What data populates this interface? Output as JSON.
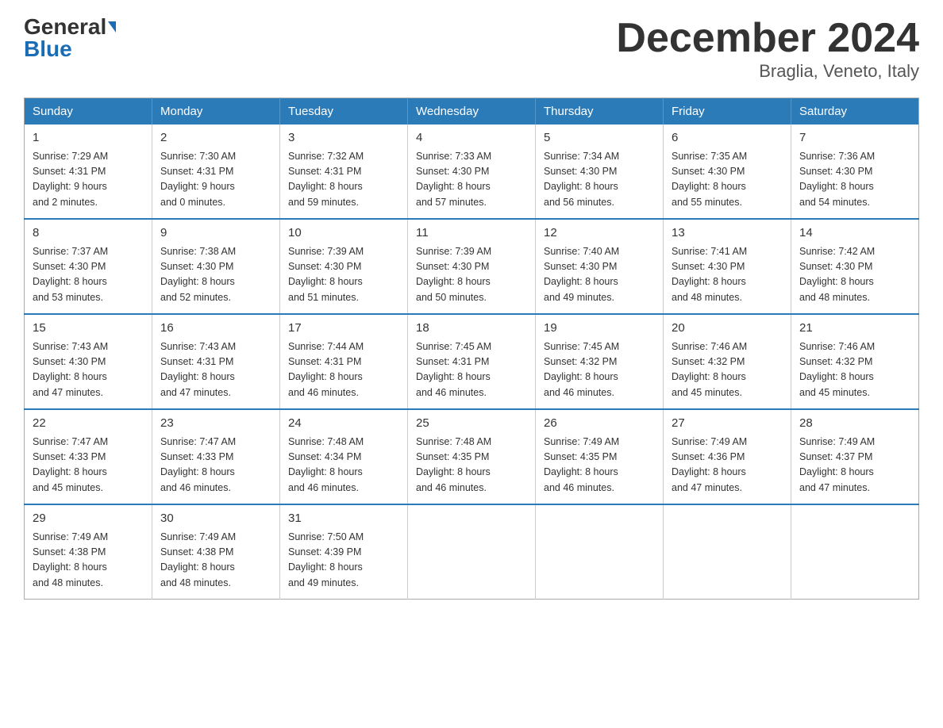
{
  "header": {
    "logo_line1": "General",
    "logo_line2": "Blue",
    "title": "December 2024",
    "subtitle": "Braglia, Veneto, Italy"
  },
  "calendar": {
    "days_of_week": [
      "Sunday",
      "Monday",
      "Tuesday",
      "Wednesday",
      "Thursday",
      "Friday",
      "Saturday"
    ],
    "weeks": [
      [
        {
          "day": "1",
          "sunrise": "7:29 AM",
          "sunset": "4:31 PM",
          "daylight": "9 hours and 2 minutes."
        },
        {
          "day": "2",
          "sunrise": "7:30 AM",
          "sunset": "4:31 PM",
          "daylight": "9 hours and 0 minutes."
        },
        {
          "day": "3",
          "sunrise": "7:32 AM",
          "sunset": "4:31 PM",
          "daylight": "8 hours and 59 minutes."
        },
        {
          "day": "4",
          "sunrise": "7:33 AM",
          "sunset": "4:30 PM",
          "daylight": "8 hours and 57 minutes."
        },
        {
          "day": "5",
          "sunrise": "7:34 AM",
          "sunset": "4:30 PM",
          "daylight": "8 hours and 56 minutes."
        },
        {
          "day": "6",
          "sunrise": "7:35 AM",
          "sunset": "4:30 PM",
          "daylight": "8 hours and 55 minutes."
        },
        {
          "day": "7",
          "sunrise": "7:36 AM",
          "sunset": "4:30 PM",
          "daylight": "8 hours and 54 minutes."
        }
      ],
      [
        {
          "day": "8",
          "sunrise": "7:37 AM",
          "sunset": "4:30 PM",
          "daylight": "8 hours and 53 minutes."
        },
        {
          "day": "9",
          "sunrise": "7:38 AM",
          "sunset": "4:30 PM",
          "daylight": "8 hours and 52 minutes."
        },
        {
          "day": "10",
          "sunrise": "7:39 AM",
          "sunset": "4:30 PM",
          "daylight": "8 hours and 51 minutes."
        },
        {
          "day": "11",
          "sunrise": "7:39 AM",
          "sunset": "4:30 PM",
          "daylight": "8 hours and 50 minutes."
        },
        {
          "day": "12",
          "sunrise": "7:40 AM",
          "sunset": "4:30 PM",
          "daylight": "8 hours and 49 minutes."
        },
        {
          "day": "13",
          "sunrise": "7:41 AM",
          "sunset": "4:30 PM",
          "daylight": "8 hours and 48 minutes."
        },
        {
          "day": "14",
          "sunrise": "7:42 AM",
          "sunset": "4:30 PM",
          "daylight": "8 hours and 48 minutes."
        }
      ],
      [
        {
          "day": "15",
          "sunrise": "7:43 AM",
          "sunset": "4:30 PM",
          "daylight": "8 hours and 47 minutes."
        },
        {
          "day": "16",
          "sunrise": "7:43 AM",
          "sunset": "4:31 PM",
          "daylight": "8 hours and 47 minutes."
        },
        {
          "day": "17",
          "sunrise": "7:44 AM",
          "sunset": "4:31 PM",
          "daylight": "8 hours and 46 minutes."
        },
        {
          "day": "18",
          "sunrise": "7:45 AM",
          "sunset": "4:31 PM",
          "daylight": "8 hours and 46 minutes."
        },
        {
          "day": "19",
          "sunrise": "7:45 AM",
          "sunset": "4:32 PM",
          "daylight": "8 hours and 46 minutes."
        },
        {
          "day": "20",
          "sunrise": "7:46 AM",
          "sunset": "4:32 PM",
          "daylight": "8 hours and 45 minutes."
        },
        {
          "day": "21",
          "sunrise": "7:46 AM",
          "sunset": "4:32 PM",
          "daylight": "8 hours and 45 minutes."
        }
      ],
      [
        {
          "day": "22",
          "sunrise": "7:47 AM",
          "sunset": "4:33 PM",
          "daylight": "8 hours and 45 minutes."
        },
        {
          "day": "23",
          "sunrise": "7:47 AM",
          "sunset": "4:33 PM",
          "daylight": "8 hours and 46 minutes."
        },
        {
          "day": "24",
          "sunrise": "7:48 AM",
          "sunset": "4:34 PM",
          "daylight": "8 hours and 46 minutes."
        },
        {
          "day": "25",
          "sunrise": "7:48 AM",
          "sunset": "4:35 PM",
          "daylight": "8 hours and 46 minutes."
        },
        {
          "day": "26",
          "sunrise": "7:49 AM",
          "sunset": "4:35 PM",
          "daylight": "8 hours and 46 minutes."
        },
        {
          "day": "27",
          "sunrise": "7:49 AM",
          "sunset": "4:36 PM",
          "daylight": "8 hours and 47 minutes."
        },
        {
          "day": "28",
          "sunrise": "7:49 AM",
          "sunset": "4:37 PM",
          "daylight": "8 hours and 47 minutes."
        }
      ],
      [
        {
          "day": "29",
          "sunrise": "7:49 AM",
          "sunset": "4:38 PM",
          "daylight": "8 hours and 48 minutes."
        },
        {
          "day": "30",
          "sunrise": "7:49 AM",
          "sunset": "4:38 PM",
          "daylight": "8 hours and 48 minutes."
        },
        {
          "day": "31",
          "sunrise": "7:50 AM",
          "sunset": "4:39 PM",
          "daylight": "8 hours and 49 minutes."
        },
        null,
        null,
        null,
        null
      ]
    ]
  }
}
